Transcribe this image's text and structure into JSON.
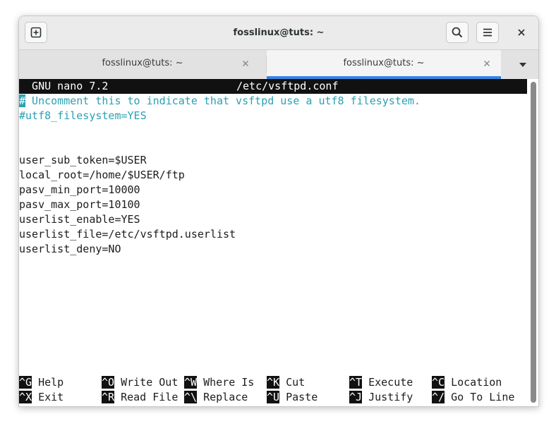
{
  "window": {
    "title": "fosslinux@tuts: ~"
  },
  "titlebar": {
    "new_tab_icon": "new-tab-icon",
    "search_icon": "search-icon",
    "menu_icon": "hamburger-menu-icon",
    "close_icon": "close-icon"
  },
  "tabs": [
    {
      "label": "fosslinux@tuts: ~",
      "active": false
    },
    {
      "label": "fosslinux@tuts: ~",
      "active": true
    }
  ],
  "nano": {
    "header_left": "  GNU nano 7.2",
    "header_file": "/etc/vsftpd.conf",
    "lines": [
      {
        "cursor": "#",
        "text": " Uncomment this to indicate that vsftpd use a utf8 filesystem.",
        "type": "comment"
      },
      {
        "text": "#utf8_filesystem=YES",
        "type": "comment"
      },
      {
        "text": "",
        "type": "plain"
      },
      {
        "text": "",
        "type": "plain"
      },
      {
        "text": "user_sub_token=$USER",
        "type": "plain"
      },
      {
        "text": "local_root=/home/$USER/ftp",
        "type": "plain"
      },
      {
        "text": "pasv_min_port=10000",
        "type": "plain"
      },
      {
        "text": "pasv_max_port=10100",
        "type": "plain"
      },
      {
        "text": "userlist_enable=YES",
        "type": "plain"
      },
      {
        "text": "userlist_file=/etc/vsftpd.userlist",
        "type": "plain"
      },
      {
        "text": "userlist_deny=NO",
        "type": "plain"
      }
    ],
    "shortcuts_row1": [
      {
        "key": "^G",
        "label": " Help"
      },
      {
        "key": "^O",
        "label": " Write Out"
      },
      {
        "key": "^W",
        "label": " Where Is"
      },
      {
        "key": "^K",
        "label": " Cut"
      },
      {
        "key": "^T",
        "label": " Execute"
      },
      {
        "key": "^C",
        "label": " Location"
      }
    ],
    "shortcuts_row2": [
      {
        "key": "^X",
        "label": " Exit"
      },
      {
        "key": "^R",
        "label": " Read File"
      },
      {
        "key": "^\\",
        "label": " Replace"
      },
      {
        "key": "^U",
        "label": " Paste"
      },
      {
        "key": "^J",
        "label": " Justify"
      },
      {
        "key": "^/",
        "label": " Go To Line"
      }
    ]
  },
  "colors": {
    "accent": "#3584e4",
    "comment": "#2aa1b3",
    "nano_bar": "#111111"
  }
}
